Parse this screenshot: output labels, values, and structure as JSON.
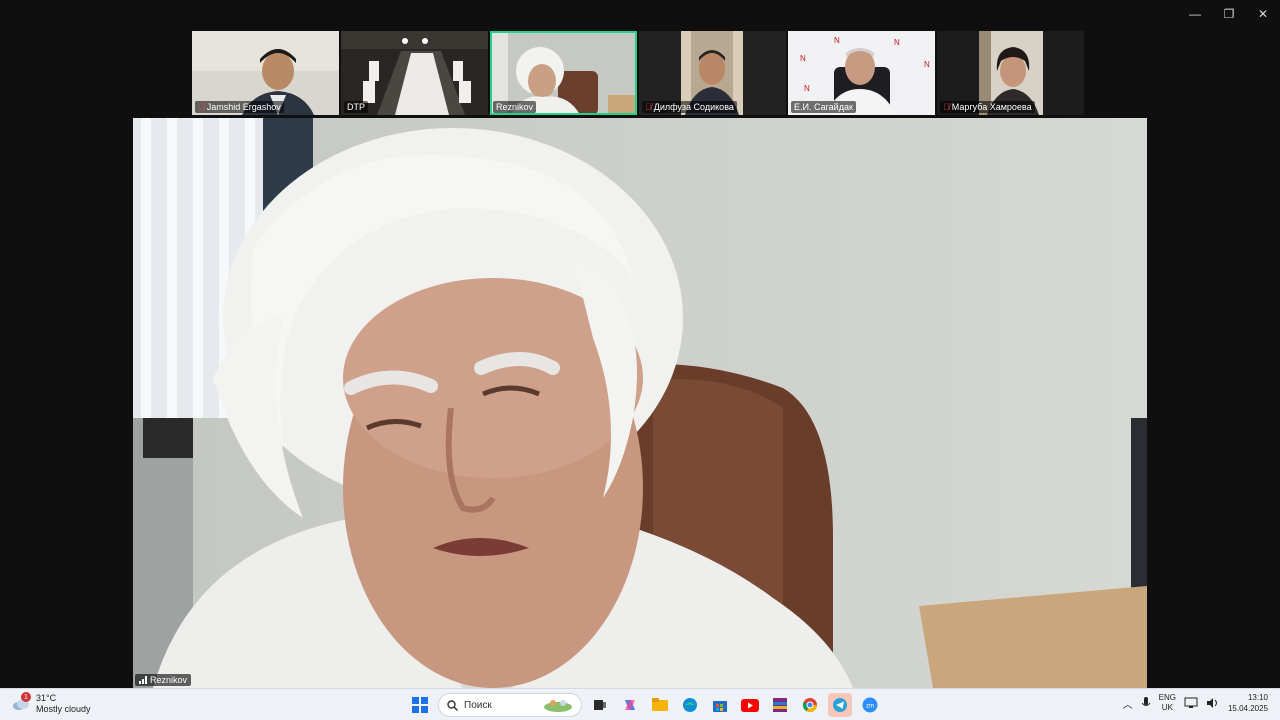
{
  "window": {
    "minimize_icon": "—",
    "restore_icon": "❐",
    "close_icon": "✕"
  },
  "participants": [
    {
      "name": "Jamshid Ergashov",
      "muted": true
    },
    {
      "name": "DTP",
      "muted": false
    },
    {
      "name": "Reznikov",
      "muted": false,
      "active": true
    },
    {
      "name": "Дилфуза Содикова",
      "muted": true
    },
    {
      "name": "Е.И. Сагайдак",
      "muted": false
    },
    {
      "name": "Маргуба Хамроева",
      "muted": true
    }
  ],
  "main_speaker": {
    "name": "Reznikov"
  },
  "taskbar": {
    "weather_temp": "31°C",
    "weather_desc": "Mostly cloudy",
    "weather_badge": "1",
    "search_placeholder": "Поиск",
    "lang_top": "ENG",
    "lang_bottom": "UK",
    "time": "13:10",
    "date": "15.04.2025"
  },
  "colors": {
    "active_border": "#23d18b",
    "mute_red": "#e5484d",
    "taskbar_bg": "#eef1f6"
  }
}
